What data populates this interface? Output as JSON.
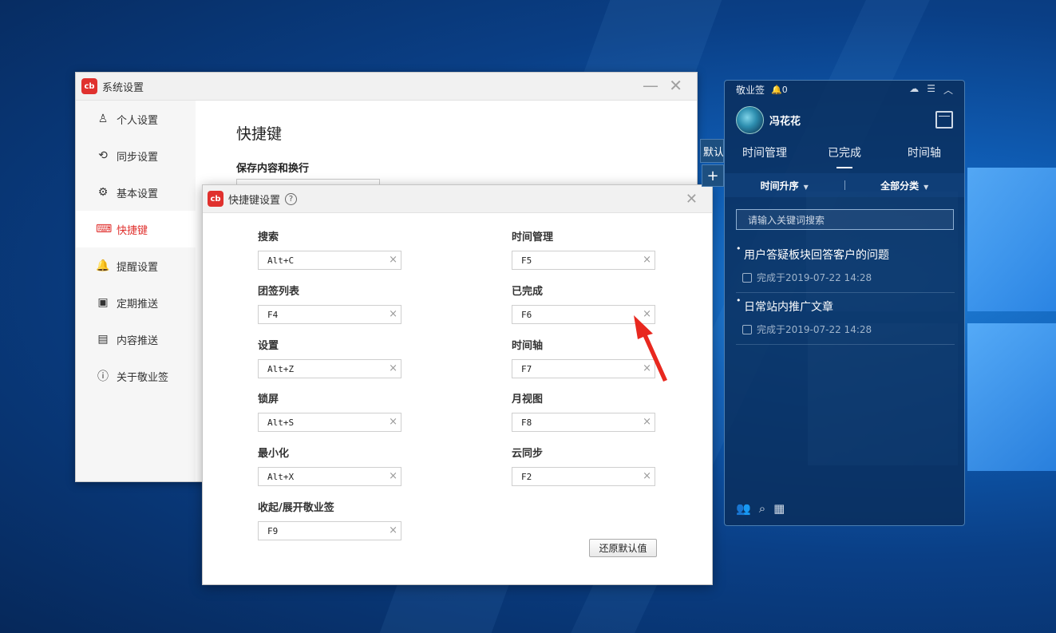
{
  "system_window": {
    "title": "系统设置",
    "logo_text": "cb",
    "sidebar": [
      {
        "label": "个人设置",
        "icon": "user-icon",
        "glyph": "♙"
      },
      {
        "label": "同步设置",
        "icon": "sync-icon",
        "glyph": "⟲"
      },
      {
        "label": "基本设置",
        "icon": "gear-icon",
        "glyph": "⚙"
      },
      {
        "label": "快捷键",
        "icon": "keyboard-icon",
        "glyph": "⌨"
      },
      {
        "label": "提醒设置",
        "icon": "bell-icon",
        "glyph": "🔔"
      },
      {
        "label": "定期推送",
        "icon": "schedule-icon",
        "glyph": "▣"
      },
      {
        "label": "内容推送",
        "icon": "content-icon",
        "glyph": "▤"
      },
      {
        "label": "关于敬业签",
        "icon": "info-icon",
        "glyph": "ⓘ"
      }
    ],
    "active_item": "快捷键",
    "page_title": "快捷键",
    "section_label": "保存内容和换行"
  },
  "shortcut_dialog": {
    "title": "快捷键设置",
    "help_glyph": "?",
    "close_glyph": "✕",
    "left_column": [
      {
        "label": "搜索",
        "value": "Alt+C"
      },
      {
        "label": "团签列表",
        "value": "F4"
      },
      {
        "label": "设置",
        "value": "Alt+Z"
      },
      {
        "label": "锁屏",
        "value": "Alt+S"
      },
      {
        "label": "最小化",
        "value": "Alt+X"
      },
      {
        "label": "收起/展开敬业签",
        "value": "F9"
      }
    ],
    "right_column": [
      {
        "label": "时间管理",
        "value": "F5"
      },
      {
        "label": "已完成",
        "value": "F6"
      },
      {
        "label": "时间轴",
        "value": "F7"
      },
      {
        "label": "月视图",
        "value": "F8"
      },
      {
        "label": "云同步",
        "value": "F2"
      }
    ],
    "clear_glyph": "×",
    "restore_button": "还原默认值",
    "annotation_color": "#e8281f"
  },
  "widget": {
    "app_name": "敬业签",
    "notification_count": "0",
    "user_name": "冯花花",
    "tabs": [
      "时间管理",
      "已完成",
      "时间轴"
    ],
    "active_tab": "已完成",
    "sort_label": "时间升序",
    "category_label": "全部分类",
    "search_placeholder": "请输入关键词搜索",
    "tasks": [
      {
        "title": "用户答疑板块回答客户的问题",
        "meta": "完成于2019-07-22 14:28"
      },
      {
        "title": "日常站内推广文章",
        "meta": "完成于2019-07-22 14:28"
      }
    ],
    "edge_tab_text": "默认",
    "edge_plus": "+"
  }
}
